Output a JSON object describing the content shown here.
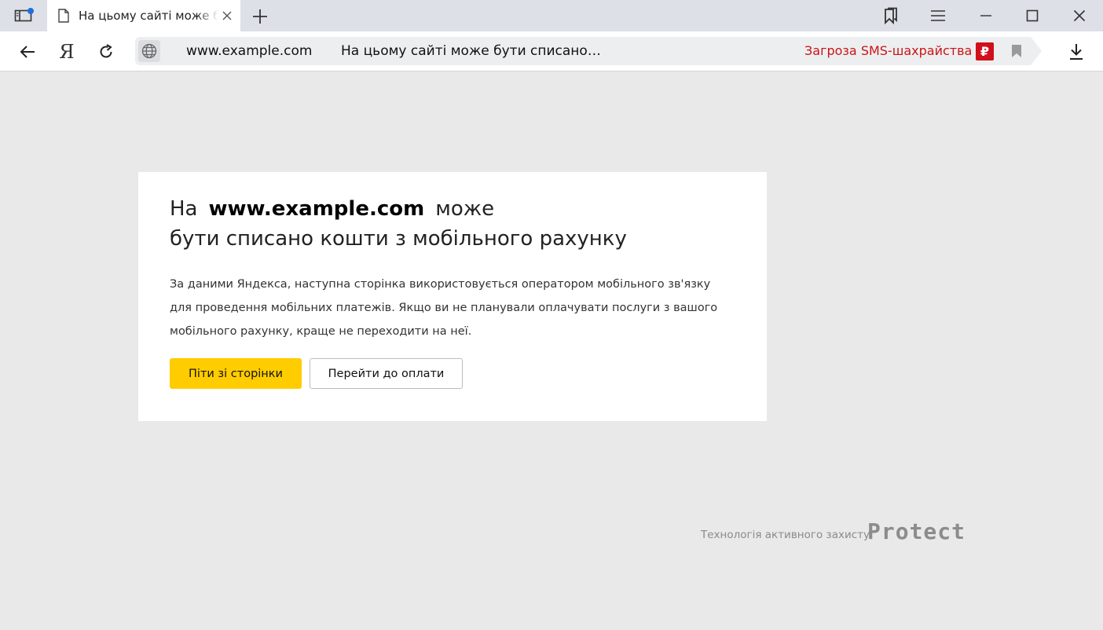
{
  "tab": {
    "title": "На цьому сайті може бути списано кошти"
  },
  "toolbar": {
    "yandex_logo": "Я",
    "url_host": "www.example.com",
    "url_title": "На цьому сайті може бути списано…",
    "threat_label": "Загроза SMS-шахрайства",
    "threat_badge": "₽"
  },
  "card": {
    "headline_pre": "На",
    "headline_host": "www.example.com",
    "headline_mid": "може",
    "headline_line2": "бути списано кошти з мобільного рахунку",
    "description": "За даними Яндекса, наступна сторінка використовується оператором мобільного зв'язку для проведення мобільних платежів. Якщо ви не планували оплачувати послуги з вашого мобільного рахунку, краще не переходити на неї.",
    "leave_button": "Піти зі сторінки",
    "proceed_button": "Перейти до оплати"
  },
  "footer": {
    "tech_label": "Технологія активного захисту",
    "brand": "Protect"
  },
  "colors": {
    "accent_yellow": "#ffcc00",
    "threat_red": "#cc1414",
    "notification_blue": "#1e6fe0"
  }
}
